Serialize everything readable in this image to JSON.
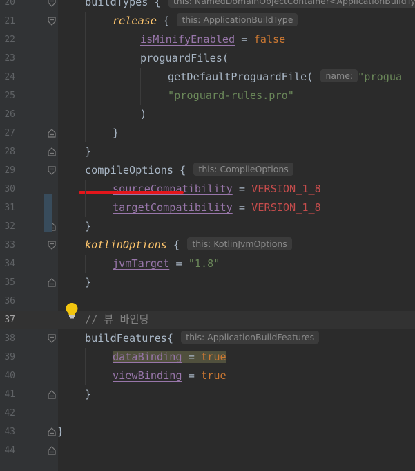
{
  "lines": [
    {
      "n": "20",
      "t": [
        [
          "",
          "buildTypes {"
        ]
      ],
      "hint": "this: NamedDomainObjectContainer<ApplicationBuildTy"
    },
    {
      "n": "21",
      "t": [
        [
          "fn-it",
          "release"
        ],
        [
          "",
          " {"
        ]
      ],
      "hint": "this: ApplicationBuildType"
    },
    {
      "n": "22",
      "t": [
        [
          "prop",
          "isMinifyEnabled"
        ],
        [
          "",
          " = "
        ],
        [
          "kw",
          "false"
        ]
      ]
    },
    {
      "n": "23",
      "t": [
        [
          "",
          "proguardFiles("
        ]
      ]
    },
    {
      "n": "24",
      "t": [
        [
          "",
          "getDefaultProguardFile("
        ]
      ],
      "hint": "name:",
      "after": [
        [
          "str",
          "\"progua"
        ]
      ]
    },
    {
      "n": "25",
      "t": [
        [
          "str",
          "\"proguard-rules.pro\""
        ]
      ]
    },
    {
      "n": "26",
      "t": [
        [
          "",
          ")"
        ]
      ]
    },
    {
      "n": "27",
      "t": [
        [
          "",
          "}"
        ]
      ]
    },
    {
      "n": "28",
      "t": [
        [
          "",
          "}"
        ]
      ]
    },
    {
      "n": "29",
      "t": [
        [
          "",
          "compileOptions {"
        ]
      ],
      "hint": "this: CompileOptions"
    },
    {
      "n": "30",
      "t": [
        [
          "prop",
          "sourceCompatibility"
        ],
        [
          "",
          " = "
        ],
        [
          "enum",
          "VERSION_1_8"
        ]
      ]
    },
    {
      "n": "31",
      "t": [
        [
          "prop",
          "targetCompatibility"
        ],
        [
          "",
          " = "
        ],
        [
          "enum",
          "VERSION_1_8"
        ]
      ]
    },
    {
      "n": "32",
      "t": [
        [
          "",
          "}"
        ]
      ]
    },
    {
      "n": "33",
      "t": [
        [
          "fn-it",
          "kotlinOptions"
        ],
        [
          "",
          " {"
        ]
      ],
      "hint": "this: KotlinJvmOptions"
    },
    {
      "n": "34",
      "t": [
        [
          "prop",
          "jvmTarget"
        ],
        [
          "",
          " = "
        ],
        [
          "str",
          "\"1.8\""
        ]
      ]
    },
    {
      "n": "35",
      "t": [
        [
          "",
          "}"
        ]
      ]
    },
    {
      "n": "36",
      "t": []
    },
    {
      "n": "37",
      "t": [
        [
          "comment",
          "// 뷰 바인딩"
        ]
      ]
    },
    {
      "n": "38",
      "t": [
        [
          "",
          "buildFeatures{"
        ]
      ],
      "hint": "this: ApplicationBuildFeatures"
    },
    {
      "n": "39",
      "t": [
        [
          "prop hl",
          "dataBinding"
        ],
        [
          "hl",
          " = "
        ],
        [
          "kw hl",
          "true"
        ]
      ]
    },
    {
      "n": "40",
      "t": [
        [
          "prop",
          "viewBinding"
        ],
        [
          "",
          " = "
        ],
        [
          "kw",
          "true"
        ]
      ]
    },
    {
      "n": "41",
      "t": [
        [
          "",
          "}"
        ]
      ]
    },
    {
      "n": "42",
      "t": []
    },
    {
      "n": "43",
      "t": [
        [
          "",
          "}"
        ]
      ]
    },
    {
      "n": "44",
      "t": []
    }
  ]
}
